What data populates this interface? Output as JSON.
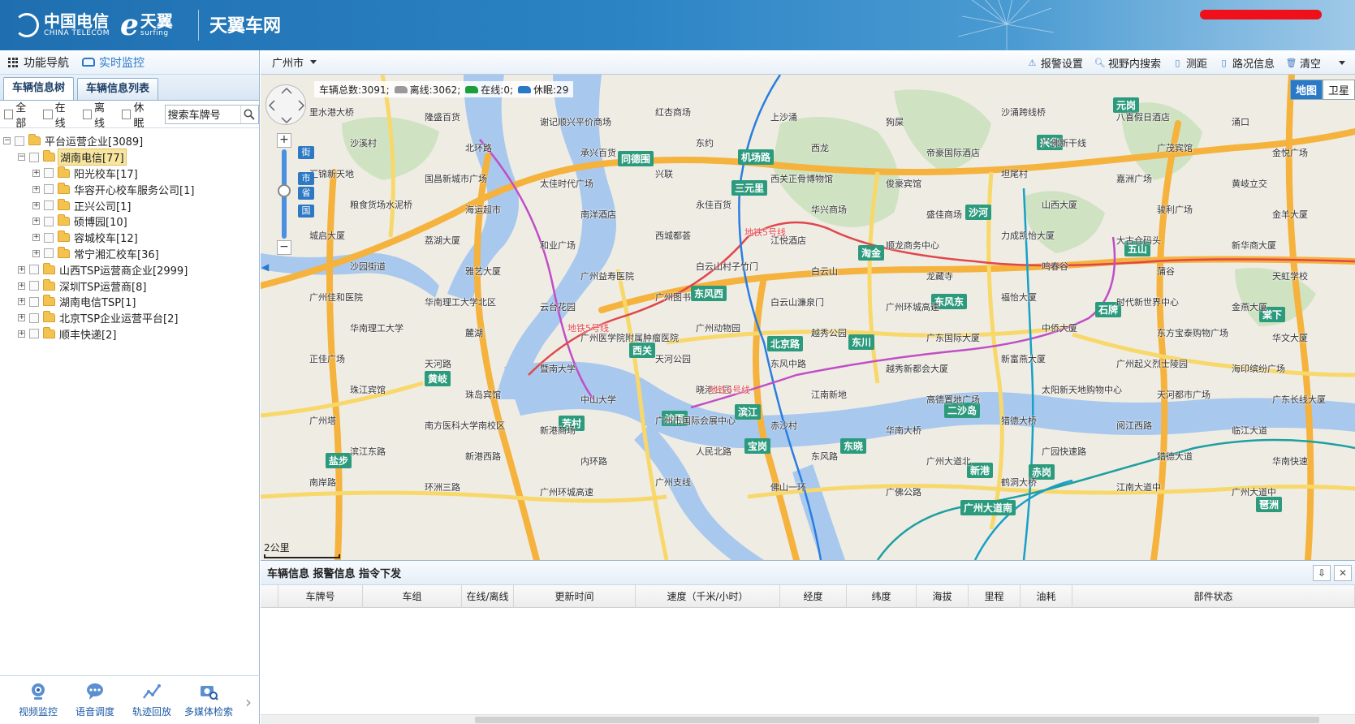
{
  "header": {
    "telecom_logo_text": "中国电信",
    "telecom_logo_sub": "CHINA TELECOM",
    "surfing_logo_text": "天翼",
    "surfing_logo_sub": "surfing",
    "site_title": "天翼车网"
  },
  "sidebar": {
    "nav_label": "功能导航",
    "realtime_label": "实时监控",
    "tabs": [
      {
        "label": "车辆信息树"
      },
      {
        "label": "车辆信息列表"
      }
    ],
    "filters": {
      "all": "全部",
      "online": "在线",
      "offline": "离线",
      "sleep": "休眠",
      "search_value": "搜索车牌号"
    },
    "tree": [
      {
        "level": 0,
        "expander": "−",
        "label": "平台运营企业[3089]",
        "folder": false
      },
      {
        "level": 1,
        "expander": "−",
        "label": "湖南电信[77]",
        "folder": true,
        "selected": true
      },
      {
        "level": 2,
        "expander": "+",
        "label": "阳光校车[17]",
        "folder": true
      },
      {
        "level": 2,
        "expander": "+",
        "label": "华容开心校车服务公司[1]",
        "folder": true
      },
      {
        "level": 2,
        "expander": "+",
        "label": "正兴公司[1]",
        "folder": true
      },
      {
        "level": 2,
        "expander": "+",
        "label": "硕博园[10]",
        "folder": true
      },
      {
        "level": 2,
        "expander": "+",
        "label": "容城校车[12]",
        "folder": true
      },
      {
        "level": 2,
        "expander": "+",
        "label": "常宁湘汇校车[36]",
        "folder": true
      },
      {
        "level": 1,
        "expander": "+",
        "label": "山西TSP运营商企业[2999]",
        "folder": true
      },
      {
        "level": 1,
        "expander": "+",
        "label": "深圳TSP运营商[8]",
        "folder": true
      },
      {
        "level": 1,
        "expander": "+",
        "label": "湖南电信TSP[1]",
        "folder": true
      },
      {
        "level": 1,
        "expander": "+",
        "label": "北京TSP企业运营平台[2]",
        "folder": true
      },
      {
        "level": 1,
        "expander": "+",
        "label": "顺丰快递[2]",
        "folder": true
      }
    ],
    "bottom_tools": [
      {
        "label": "视频监控",
        "icon": "camera-icon"
      },
      {
        "label": "语音调度",
        "icon": "chat-icon"
      },
      {
        "label": "轨迹回放",
        "icon": "track-icon"
      },
      {
        "label": "多媒体检索",
        "icon": "media-search-icon"
      }
    ]
  },
  "toolbar": {
    "city": "广州市",
    "buttons": [
      {
        "label": "报警设置",
        "icon": "warning-icon"
      },
      {
        "label": "视野内搜索",
        "icon": "search-icon"
      },
      {
        "label": "测距",
        "icon": "ruler-icon"
      },
      {
        "label": "路况信息",
        "icon": "traffic-icon"
      },
      {
        "label": "清空",
        "icon": "trash-icon"
      }
    ]
  },
  "map": {
    "stats": {
      "total_label": "车辆总数:3091;",
      "offline_label": "离线:3062;",
      "online_label": "在线:0;",
      "sleep_label": "休眠:29"
    },
    "zoom_tags": [
      "街",
      "市",
      "省",
      "国"
    ],
    "map_types": [
      "地图",
      "卫星"
    ],
    "scale_label": "2公里",
    "colors": {
      "online_car": "#1e9e3a",
      "offline_car": "#9a9a9a",
      "sleep_car": "#2a78c8",
      "metro_line": "#e0474c",
      "station": "#2c9a7c"
    },
    "stations": [
      "同德围",
      "机场路",
      "三元里",
      "沙河",
      "淘金",
      "五山",
      "东风西",
      "东风东",
      "石牌",
      "北京路",
      "东川",
      "西关",
      "黄岐",
      "芳村",
      "沙面",
      "滨江",
      "宝岗",
      "东晓",
      "二沙岛",
      "新港",
      "赤岗",
      "琶洲",
      "广州大道南",
      "盐步",
      "兴华",
      "元岗",
      "棠下"
    ],
    "places": [
      "里水港大桥",
      "隆盛百货",
      "谢记顺兴平价商场",
      "红杏商场",
      "上沙涌",
      "狗屎",
      "沙涌跨线桥",
      "八喜假日酒店",
      "涌口",
      "沙溪村",
      "北环路",
      "承兴百货",
      "东约",
      "西龙",
      "帝豪国际酒店",
      "广佛新干线",
      "广茂宾馆",
      "金悦广场",
      "汇锦新天地",
      "国昌新城市广场",
      "太佳时代广场",
      "兴联",
      "西关正骨博物馆",
      "俊豪宾馆",
      "坦尾村",
      "嘉洲广场",
      "黄岐立交",
      "粮食货场水泥桥",
      "海运超市",
      "南洋酒店",
      "永佳百货",
      "华兴商场",
      "盛佳商场",
      "山西大厦",
      "骏利广场",
      "金羊大厦",
      "城启大厦",
      "荔湖大厦",
      "和业广场",
      "西城都荟",
      "江悦酒店",
      "顺龙商务中心",
      "力成凯怡大厦",
      "大古仓码头",
      "新华商大厦",
      "沙园街道",
      "雅艺大厦",
      "广州益寿医院",
      "白云山村子竹门",
      "白云山",
      "龙藏寺",
      "鸣春谷",
      "蒲谷",
      "天虹学校",
      "广州佳和医院",
      "华南理工大学北区",
      "云台花园",
      "广州图书",
      "白云山濂泉门",
      "广州环城高速",
      "福怡大厦",
      "时代新世界中心",
      "金燕大厦",
      "华南理工大学",
      "麓湖",
      "广州医学院附属肿瘤医院",
      "广州动物园",
      "越秀公园",
      "广东国际大厦",
      "中侨大厦",
      "东方宝泰购物广场",
      "华文大厦",
      "正佳广场",
      "天河路",
      "暨南大学",
      "天河公园",
      "东风中路",
      "越秀新都会大厦",
      "新富燕大厦",
      "广州起义烈士陵园",
      "海印缤纷广场",
      "珠江宾馆",
      "珠岛宾馆",
      "中山大学",
      "晓港公园",
      "江南新地",
      "高德置地广场",
      "太阳新天地购物中心",
      "天河都市广场",
      "广东长线大厦",
      "广州塔",
      "南方医科大学南校区",
      "新港商场",
      "广州市国际会展中心",
      "赤沙村",
      "华南大桥",
      "猎德大桥",
      "阅江西路",
      "临江大道",
      "滨江东路",
      "新港西路",
      "内环路",
      "人民北路",
      "东风路",
      "广州大道北",
      "广园快速路",
      "猎德大道",
      "华南快速",
      "南岸路",
      "环洲三路",
      "广州环城高速",
      "广州支线",
      "佛山一环",
      "广佛公路",
      "鹤洞大桥",
      "江南大道中",
      "广州大道中"
    ],
    "metro_labels": [
      "地铁5号线",
      "地铁5号线",
      "地铁6号线"
    ]
  },
  "info_panel": {
    "title": "车辆信息 报警信息 指令下发",
    "columns": [
      "",
      "车牌号",
      "车组",
      "在线/离线",
      "更新时间",
      "速度（千米/小时）",
      "经度",
      "纬度",
      "海拔",
      "里程",
      "油耗",
      "部件状态"
    ]
  }
}
